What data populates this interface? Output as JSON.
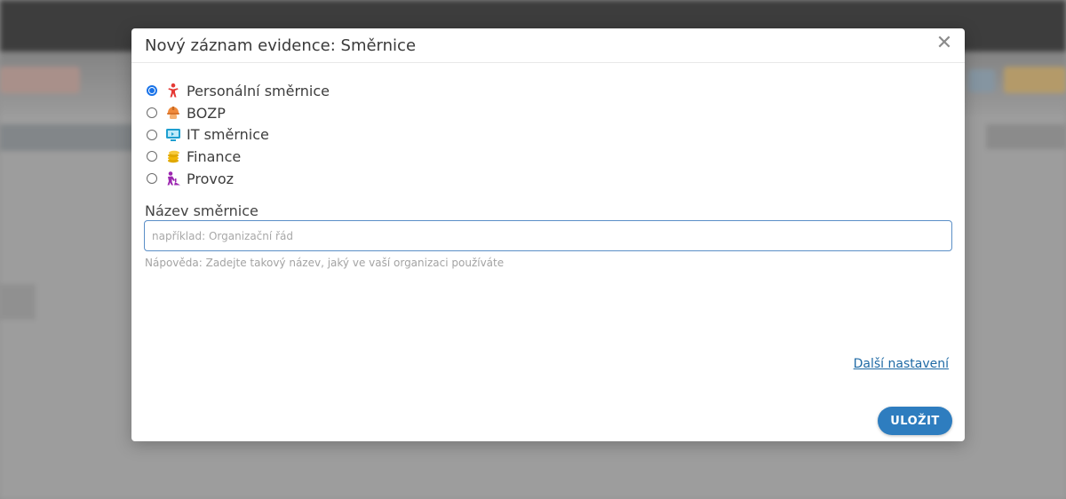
{
  "modal": {
    "title": "Nový záznam evidence: Směrnice",
    "close_label": "✕",
    "options": [
      {
        "label": "Personální směrnice",
        "icon": "person-icon",
        "checked": true,
        "color": "#e53935"
      },
      {
        "label": "BOZP",
        "icon": "hardhat-icon",
        "checked": false,
        "color": "#f08a3b"
      },
      {
        "label": "IT směrnice",
        "icon": "monitor-icon",
        "checked": false,
        "color": "#1e9fd0"
      },
      {
        "label": "Finance",
        "icon": "coins-icon",
        "checked": false,
        "color": "#f2b705"
      },
      {
        "label": "Provoz",
        "icon": "worker-icon",
        "checked": false,
        "color": "#9c27b0"
      }
    ],
    "field": {
      "label": "Název směrnice",
      "value": "",
      "placeholder": "například: Organizační řád",
      "help": "Nápověda: Zadejte takový název, jaký ve vaší organizaci používáte"
    },
    "more_settings_link": "Další nastavení",
    "save_label": "ULOŽIT"
  },
  "colors": {
    "accent": "#2e7dbf",
    "link": "#1f6aa5",
    "radio_checked": "#1a73e8"
  }
}
